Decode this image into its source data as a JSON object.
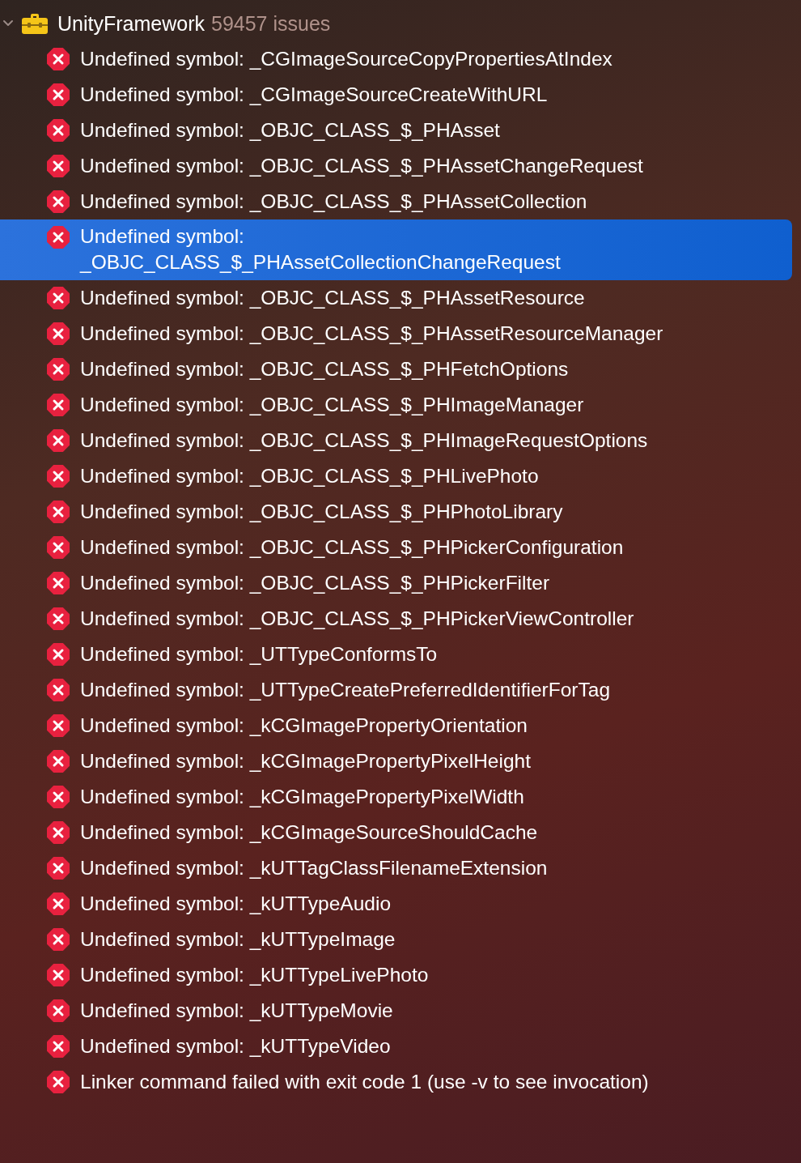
{
  "group": {
    "title": "UnityFramework",
    "count": "59457 issues",
    "expanded": true
  },
  "issues": [
    {
      "kind": "error",
      "message": "Undefined symbol: _CGImageSourceCopyPropertiesAtIndex",
      "selected": false
    },
    {
      "kind": "error",
      "message": "Undefined symbol: _CGImageSourceCreateWithURL",
      "selected": false
    },
    {
      "kind": "error",
      "message": "Undefined symbol: _OBJC_CLASS_$_PHAsset",
      "selected": false
    },
    {
      "kind": "error",
      "message": "Undefined symbol: _OBJC_CLASS_$_PHAssetChangeRequest",
      "selected": false
    },
    {
      "kind": "error",
      "message": "Undefined symbol: _OBJC_CLASS_$_PHAssetCollection",
      "selected": false
    },
    {
      "kind": "error",
      "message": "Undefined symbol: _OBJC_CLASS_$_PHAssetCollectionChangeRequest",
      "selected": true
    },
    {
      "kind": "error",
      "message": "Undefined symbol: _OBJC_CLASS_$_PHAssetResource",
      "selected": false
    },
    {
      "kind": "error",
      "message": "Undefined symbol: _OBJC_CLASS_$_PHAssetResourceManager",
      "selected": false
    },
    {
      "kind": "error",
      "message": "Undefined symbol: _OBJC_CLASS_$_PHFetchOptions",
      "selected": false
    },
    {
      "kind": "error",
      "message": "Undefined symbol: _OBJC_CLASS_$_PHImageManager",
      "selected": false
    },
    {
      "kind": "error",
      "message": "Undefined symbol: _OBJC_CLASS_$_PHImageRequestOptions",
      "selected": false
    },
    {
      "kind": "error",
      "message": "Undefined symbol: _OBJC_CLASS_$_PHLivePhoto",
      "selected": false
    },
    {
      "kind": "error",
      "message": "Undefined symbol: _OBJC_CLASS_$_PHPhotoLibrary",
      "selected": false
    },
    {
      "kind": "error",
      "message": "Undefined symbol: _OBJC_CLASS_$_PHPickerConfiguration",
      "selected": false
    },
    {
      "kind": "error",
      "message": "Undefined symbol: _OBJC_CLASS_$_PHPickerFilter",
      "selected": false
    },
    {
      "kind": "error",
      "message": "Undefined symbol: _OBJC_CLASS_$_PHPickerViewController",
      "selected": false
    },
    {
      "kind": "error",
      "message": "Undefined symbol: _UTTypeConformsTo",
      "selected": false
    },
    {
      "kind": "error",
      "message": "Undefined symbol: _UTTypeCreatePreferredIdentifierForTag",
      "selected": false
    },
    {
      "kind": "error",
      "message": "Undefined symbol: _kCGImagePropertyOrientation",
      "selected": false
    },
    {
      "kind": "error",
      "message": "Undefined symbol: _kCGImagePropertyPixelHeight",
      "selected": false
    },
    {
      "kind": "error",
      "message": "Undefined symbol: _kCGImagePropertyPixelWidth",
      "selected": false
    },
    {
      "kind": "error",
      "message": "Undefined symbol: _kCGImageSourceShouldCache",
      "selected": false
    },
    {
      "kind": "error",
      "message": "Undefined symbol: _kUTTagClassFilenameExtension",
      "selected": false
    },
    {
      "kind": "error",
      "message": "Undefined symbol: _kUTTypeAudio",
      "selected": false
    },
    {
      "kind": "error",
      "message": "Undefined symbol: _kUTTypeImage",
      "selected": false
    },
    {
      "kind": "error",
      "message": "Undefined symbol: _kUTTypeLivePhoto",
      "selected": false
    },
    {
      "kind": "error",
      "message": "Undefined symbol: _kUTTypeMovie",
      "selected": false
    },
    {
      "kind": "error",
      "message": "Undefined symbol: _kUTTypeVideo",
      "selected": false
    },
    {
      "kind": "error",
      "message": "Linker command failed with exit code 1 (use -v to see invocation)",
      "selected": false
    }
  ]
}
